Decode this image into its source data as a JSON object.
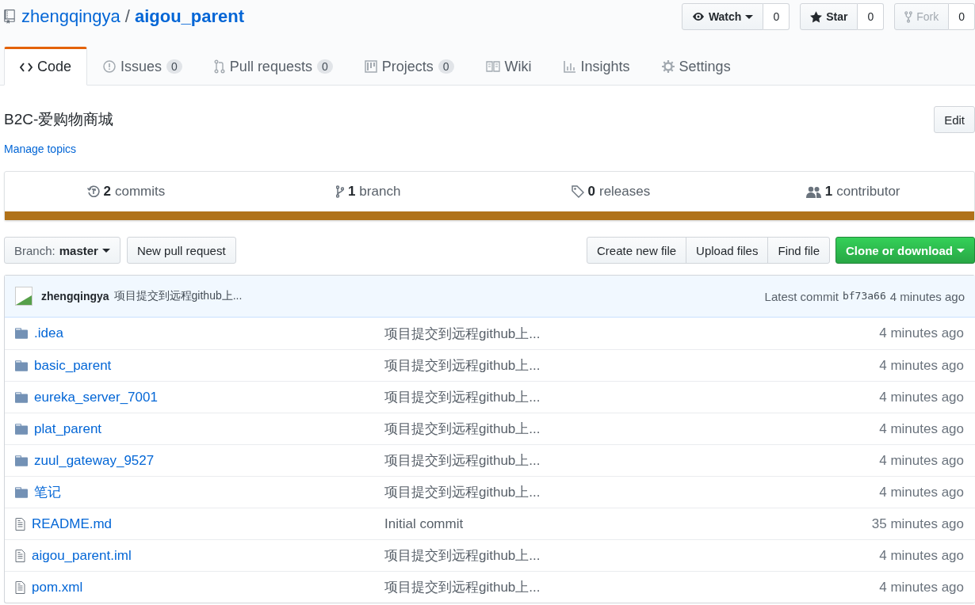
{
  "repo": {
    "owner": "zhengqingya",
    "separator": "/",
    "name": "aigou_parent"
  },
  "actions": [
    {
      "kind": "watch",
      "label": "Watch",
      "count": "0",
      "disabled": false
    },
    {
      "kind": "star",
      "label": "Star",
      "count": "0",
      "disabled": false
    },
    {
      "kind": "fork",
      "label": "Fork",
      "count": "0",
      "disabled": true
    }
  ],
  "tabs": [
    {
      "kind": "code",
      "label": "Code",
      "selected": true
    },
    {
      "kind": "issues",
      "label": "Issues",
      "count": "0",
      "selected": false
    },
    {
      "kind": "pulls",
      "label": "Pull requests",
      "count": "0",
      "selected": false
    },
    {
      "kind": "projects",
      "label": "Projects",
      "count": "0",
      "selected": false
    },
    {
      "kind": "wiki",
      "label": "Wiki",
      "selected": false
    },
    {
      "kind": "insights",
      "label": "Insights",
      "selected": false
    },
    {
      "kind": "settings",
      "label": "Settings",
      "selected": false
    }
  ],
  "description": "B2C-爱购物商城",
  "edit_button": "Edit",
  "topics_link": "Manage topics",
  "summary": [
    {
      "kind": "commits",
      "number": "2",
      "label": "commits"
    },
    {
      "kind": "branch",
      "number": "1",
      "label": "branch"
    },
    {
      "kind": "releases",
      "number": "0",
      "label": "releases"
    },
    {
      "kind": "contributors",
      "number": "1",
      "label": "contributor"
    }
  ],
  "branch_select": {
    "label": "Branch:",
    "value": "master"
  },
  "new_pull_request": "New pull request",
  "file_buttons": [
    "Create new file",
    "Upload files",
    "Find file"
  ],
  "clone_button": "Clone or download",
  "commit": {
    "author": "zhengqingya",
    "message": "项目提交到远程github上...",
    "latest_label": "Latest commit",
    "sha": "bf73a66",
    "time": "4 minutes ago"
  },
  "files": [
    {
      "kind": "folder",
      "name": ".idea",
      "message": "项目提交到远程github上...",
      "age": "4 minutes ago"
    },
    {
      "kind": "folder",
      "name": "basic_parent",
      "message": "项目提交到远程github上...",
      "age": "4 minutes ago"
    },
    {
      "kind": "folder",
      "name": "eureka_server_7001",
      "message": "项目提交到远程github上...",
      "age": "4 minutes ago"
    },
    {
      "kind": "folder",
      "name": "plat_parent",
      "message": "项目提交到远程github上...",
      "age": "4 minutes ago"
    },
    {
      "kind": "folder",
      "name": "zuul_gateway_9527",
      "message": "项目提交到远程github上...",
      "age": "4 minutes ago"
    },
    {
      "kind": "folder",
      "name": "笔记",
      "message": "项目提交到远程github上...",
      "age": "4 minutes ago"
    },
    {
      "kind": "file",
      "name": "README.md",
      "message": "Initial commit",
      "age": "35 minutes ago"
    },
    {
      "kind": "file",
      "name": "aigou_parent.iml",
      "message": "项目提交到远程github上...",
      "age": "4 minutes ago"
    },
    {
      "kind": "file",
      "name": "pom.xml",
      "message": "项目提交到远程github上...",
      "age": "4 minutes ago"
    }
  ]
}
